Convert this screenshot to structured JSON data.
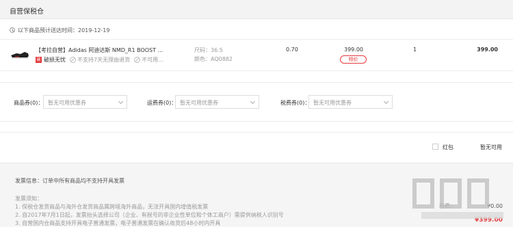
{
  "warehouse": {
    "title": "自营保税仓"
  },
  "delivery": {
    "text": "以下商品预计送达时间：2019-12-19"
  },
  "product": {
    "name": "【考拉自营】Adidas 阿迪达斯 NMD_R1 BOOST ...",
    "broken_badge": "破",
    "broken_label": "破损无忧",
    "tag_no_return": "不支持7天无理由退货",
    "tag_unavailable": "不可用...",
    "size": "尺码：36.5",
    "color": "颜色：AQ0882",
    "weight": "0.70",
    "price": "399.00",
    "special_label": "特价",
    "quantity": "1",
    "subtotal": "399.00"
  },
  "coupons": {
    "item": {
      "label": "商品券(0)：",
      "value": "暂无可用优惠券"
    },
    "shipping": {
      "label": "运费券(0)：",
      "value": "暂无可用优惠券"
    },
    "tax": {
      "label": "税费券(0)：",
      "value": "暂无可用优惠券"
    }
  },
  "red_packet": {
    "label": "红包",
    "value": "暂无可用"
  },
  "invoice": {
    "info": "发票信息：订单中所有商品均不支持开具发票",
    "notice_title": "发票须知：",
    "notice_lines": [
      "1. 保税仓发货商品与海外仓发货商品属跨境海外商品，无法开具国内增值税发票",
      "2. 自2017年7月1日起，发票抬头选择公司（企业、有税号的非企业性单位和个体工商户）需提供纳税人识别号",
      "3. 自营国内仓商品支持开具电子普通发票，电子普通发票在确认收货后48小时内开具"
    ]
  },
  "summary": {
    "tax_label": "税费：",
    "tax_value": "¥0.00",
    "total": "¥399.00"
  },
  "colors": {
    "accent": "#e4393c",
    "header_bg": "#f3f3f3",
    "footer_bg": "#f5f5f5"
  },
  "icons": [
    "clock-icon",
    "shoe-thumbnail",
    "no-return-icon",
    "chevron-down-icon",
    "checkbox-icon"
  ]
}
